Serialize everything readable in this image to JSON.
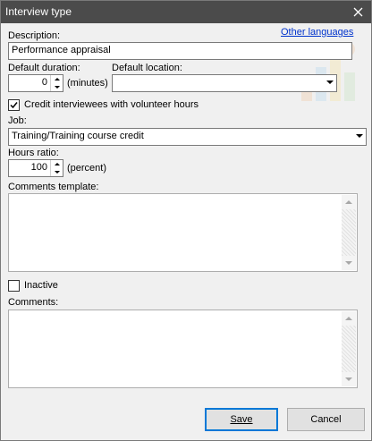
{
  "window": {
    "title": "Interview type"
  },
  "description": {
    "label": "Description:",
    "value": "Performance appraisal",
    "other_languages_link": "Other languages"
  },
  "default_duration": {
    "label": "Default duration:",
    "value": "0",
    "unit": "(minutes)"
  },
  "default_location": {
    "label": "Default location:",
    "value": ""
  },
  "credit_volunteer": {
    "label": "Credit interviewees with volunteer hours",
    "checked": true
  },
  "job": {
    "label": "Job:",
    "value": "Training/Training course credit"
  },
  "hours_ratio": {
    "label": "Hours ratio:",
    "value": "100",
    "unit": "(percent)"
  },
  "comments_template": {
    "label": "Comments template:",
    "value": ""
  },
  "inactive": {
    "label": "Inactive",
    "checked": false
  },
  "comments": {
    "label": "Comments:",
    "value": ""
  },
  "buttons": {
    "save": "Save",
    "cancel": "Cancel"
  },
  "colors": {
    "titlebar": "#4b4b4b",
    "link": "#0033cc",
    "default_button_border": "#0078d7",
    "dialog_bg": "#f0f0f0"
  },
  "icons": {
    "close": "close-icon",
    "decoration": "decorative-watermark"
  }
}
